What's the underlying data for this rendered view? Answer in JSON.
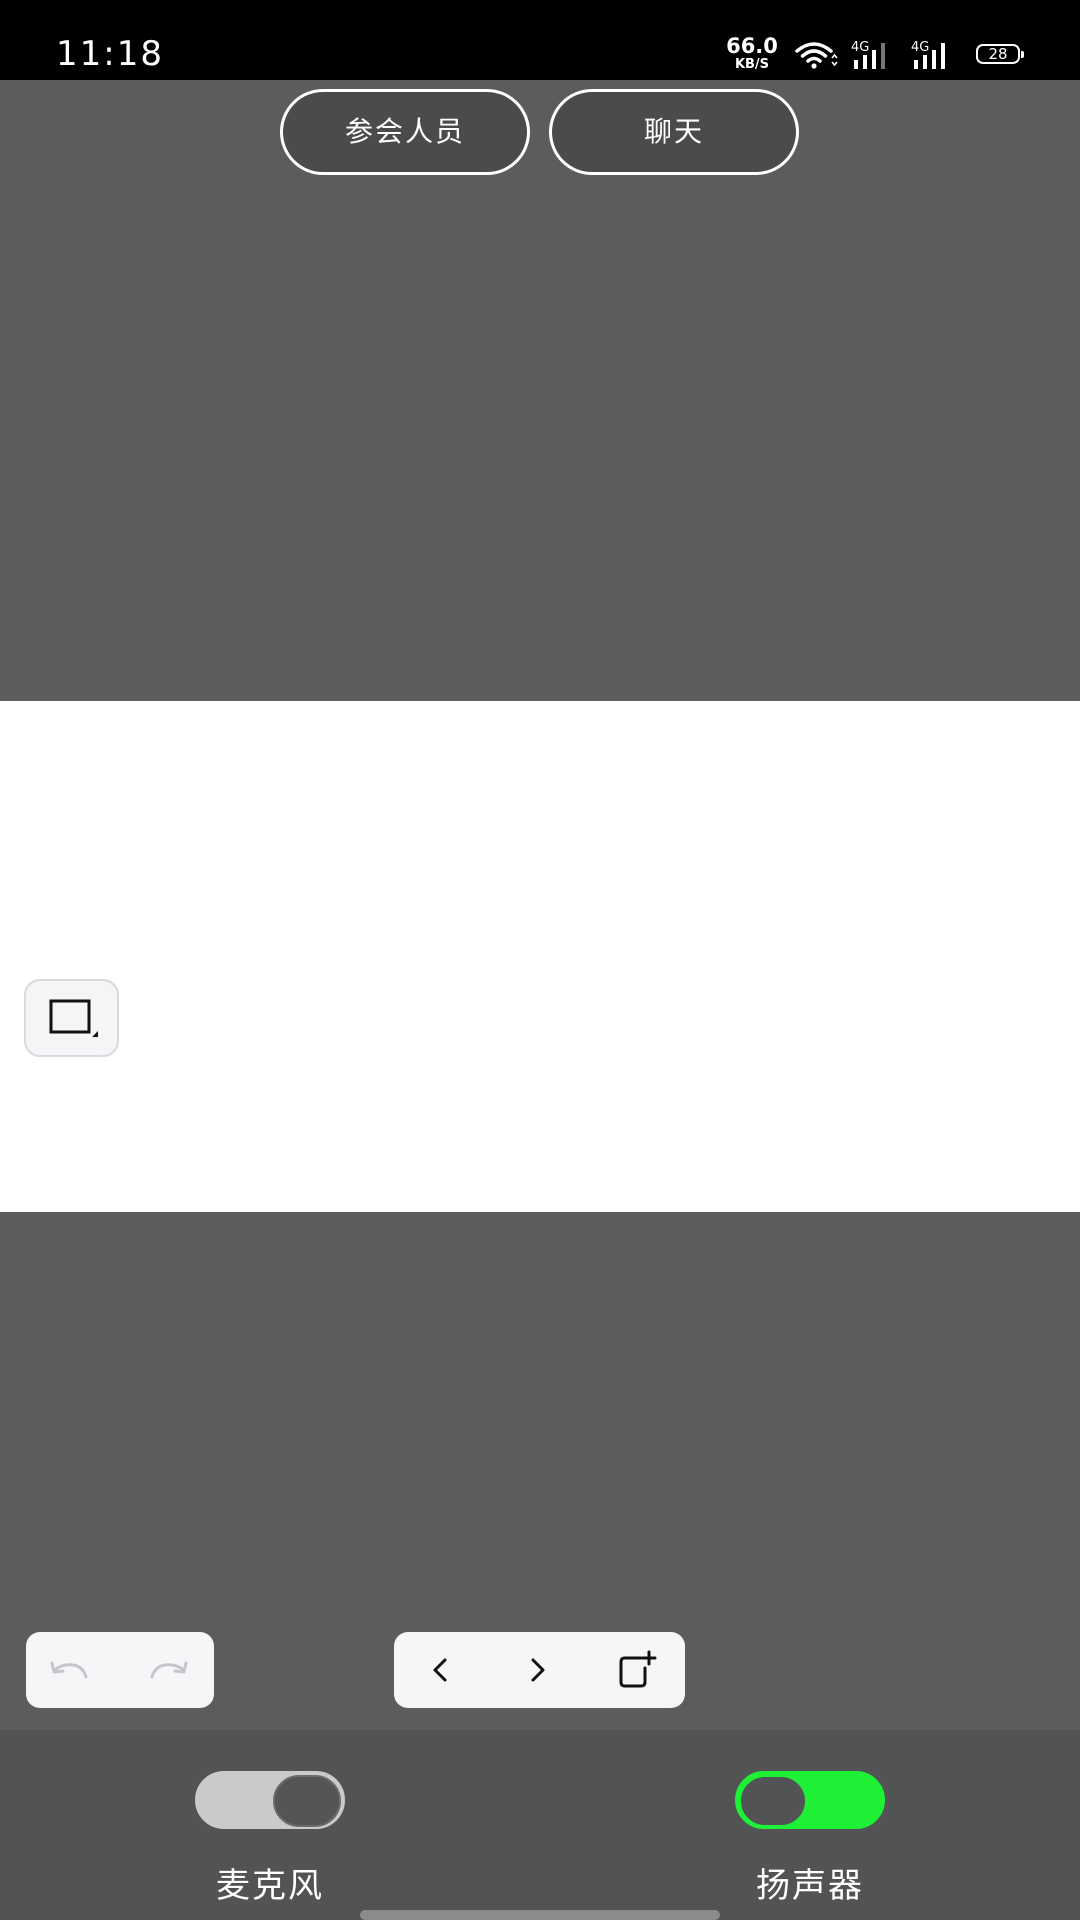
{
  "status_bar": {
    "time": "11:18",
    "net_speed_value": "66.0",
    "net_speed_unit": "KB/S",
    "signal_1_label": "4G",
    "signal_2_label": "4G",
    "battery_level": "28",
    "icons": [
      "wifi-icon",
      "signal-icon",
      "signal-icon",
      "battery-icon"
    ]
  },
  "top_buttons": {
    "participants_label": "参会人员",
    "chat_label": "聊天"
  },
  "whiteboard": {
    "shape_tool_icon": "rectangle-icon"
  },
  "toolbar": {
    "undo_icon": "undo-icon",
    "redo_icon": "redo-icon",
    "prev_icon": "chevron-left-icon",
    "next_icon": "chevron-right-icon",
    "add_page_icon": "add-page-icon"
  },
  "controls": {
    "microphone": {
      "label": "麦克风",
      "on": false
    },
    "speaker": {
      "label": "扬声器",
      "on": true
    }
  },
  "colors": {
    "background": "#5b5c5e",
    "control_panel": "#525355",
    "toggle_on": "#1ef135",
    "toggle_off": "#c9cacc"
  }
}
